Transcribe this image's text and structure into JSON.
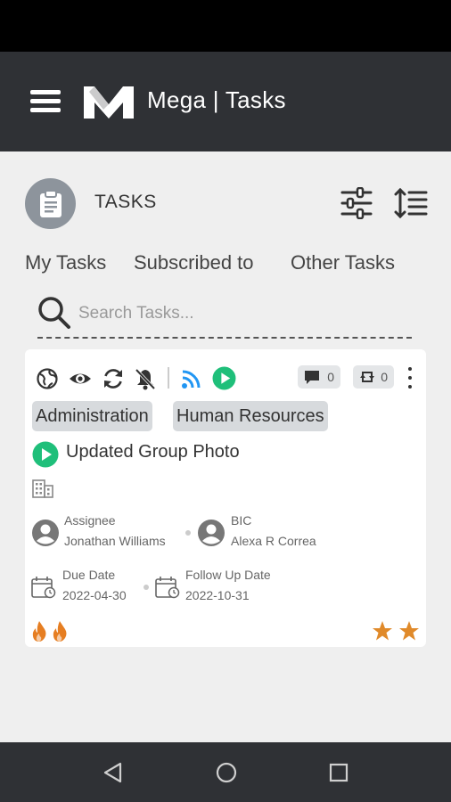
{
  "app": {
    "title": "Mega | Tasks"
  },
  "header": {
    "heading": "TASKS"
  },
  "tabs": [
    {
      "label": "My Tasks"
    },
    {
      "label": "Subscribed to"
    },
    {
      "label": "Other Tasks"
    }
  ],
  "search": {
    "placeholder": "Search Tasks..."
  },
  "card": {
    "comment_count": "0",
    "sync_count": "0",
    "tags": [
      "Administration",
      "Human Resources"
    ],
    "title": "Updated Group Photo",
    "assignee_label": "Assignee",
    "assignee_name": "Jonathan Williams",
    "bic_label": "BIC",
    "bic_name": "Alexa R Correa",
    "due_label": "Due Date",
    "due_date": "2022-04-30",
    "followup_label": "Follow Up Date",
    "followup_date": "2022-10-31",
    "priority_flames": 2,
    "stars": 2
  },
  "colors": {
    "appbar": "#2f3135",
    "play": "#1fbf7a",
    "rss": "#2196f3",
    "flame": "#e67e22",
    "star": "#e08a2a"
  },
  "icons": [
    "menu-icon",
    "mega-logo",
    "clipboard-icon",
    "filter-icon",
    "sort-icon",
    "search-icon",
    "globe-icon",
    "eye-icon",
    "refresh-icon",
    "bell-off-icon",
    "rss-icon",
    "play-icon",
    "comment-icon",
    "sync-icon",
    "kebab-icon",
    "building-icon",
    "person-icon",
    "calendar-icon",
    "flame-icon",
    "star-icon",
    "back-icon",
    "home-icon",
    "recents-icon"
  ]
}
